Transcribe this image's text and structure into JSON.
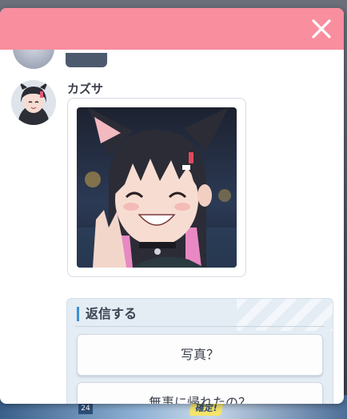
{
  "dialog": {
    "header_color": "#f98e9f",
    "close_icon": "close-icon"
  },
  "message": {
    "sender": "カズサ"
  },
  "reply": {
    "title": "返信する",
    "options": [
      {
        "label": "写真？"
      },
      {
        "label": "無事に帰れたの？"
      }
    ]
  },
  "background": {
    "badge_text": "確定!",
    "counter_text": "24"
  }
}
